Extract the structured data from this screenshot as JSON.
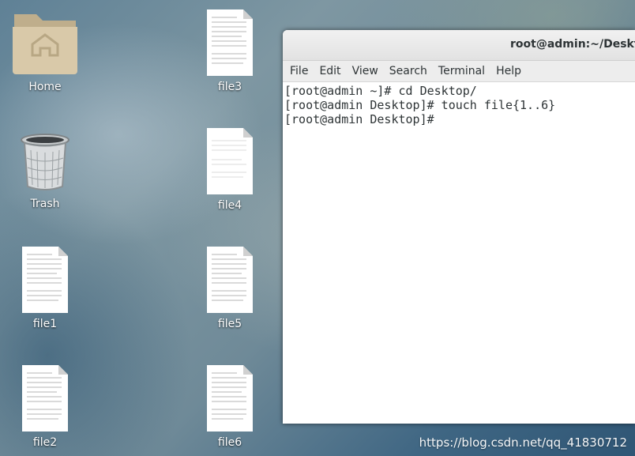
{
  "desktop": {
    "home_label": "Home",
    "trash_label": "Trash",
    "files": [
      "file1",
      "file2",
      "file3",
      "file4",
      "file5",
      "file6"
    ]
  },
  "terminal": {
    "title": "root@admin:~/Desktop",
    "menu": [
      "File",
      "Edit",
      "View",
      "Search",
      "Terminal",
      "Help"
    ],
    "lines": [
      "[root@admin ~]# cd Desktop/",
      "[root@admin Desktop]# touch file{1..6}",
      "[root@admin Desktop]#"
    ]
  },
  "watermark": "https://blog.csdn.net/qq_41830712",
  "colors": {
    "folder": "#d8c8a8",
    "folder_dark": "#bfae8c",
    "terminal_bg": "#ffffff"
  }
}
